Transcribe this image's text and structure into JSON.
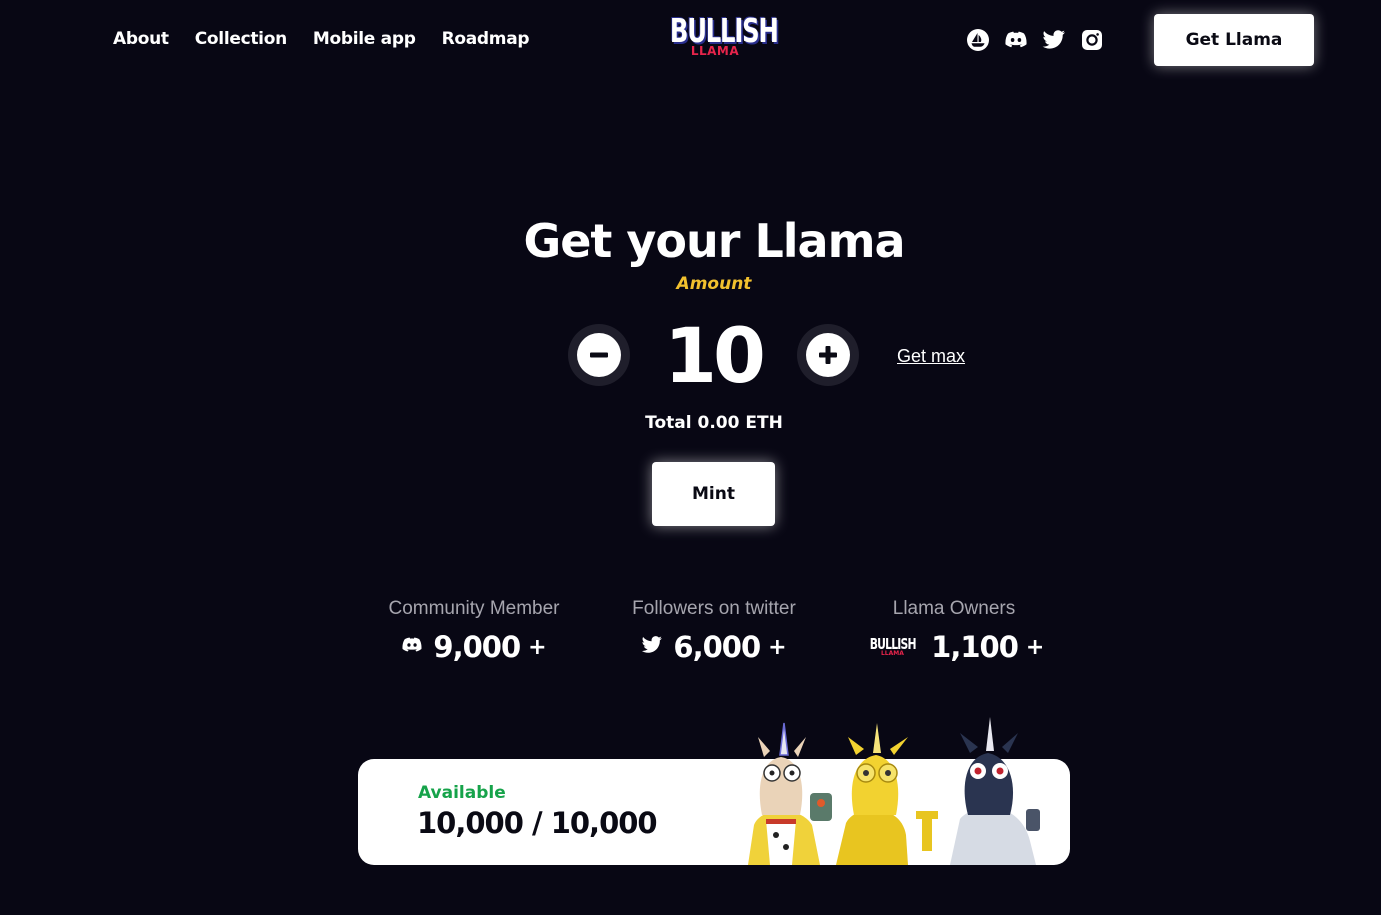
{
  "nav": {
    "links": [
      "About",
      "Collection",
      "Mobile app",
      "Roadmap"
    ],
    "logo_top": "BULLISH",
    "logo_bottom": "LLAMA",
    "socials": [
      "opensea-icon",
      "discord-icon",
      "twitter-icon",
      "instagram-icon"
    ],
    "cta_label": "Get Llama"
  },
  "hero": {
    "title": "Get your Llama",
    "amount_label": "Amount",
    "amount_value": "10",
    "get_max_label": "Get max",
    "total_label": "Total 0.00 ETH",
    "mint_label": "Mint"
  },
  "stats": [
    {
      "label": "Community Member",
      "icon": "discord-icon",
      "value": "9,000",
      "suffix": "+"
    },
    {
      "label": "Followers on twitter",
      "icon": "twitter-icon",
      "value": "6,000",
      "suffix": "+"
    },
    {
      "label": "Llama Owners",
      "icon": "bullish-llama-logo",
      "value": "1,100",
      "suffix": "+"
    }
  ],
  "available": {
    "label": "Available",
    "value": "10,000 / 10,000"
  },
  "colors": {
    "background": "#080714",
    "accent_yellow": "#f2c12e",
    "accent_green": "#16a34a",
    "logo_red": "#e6244b"
  }
}
